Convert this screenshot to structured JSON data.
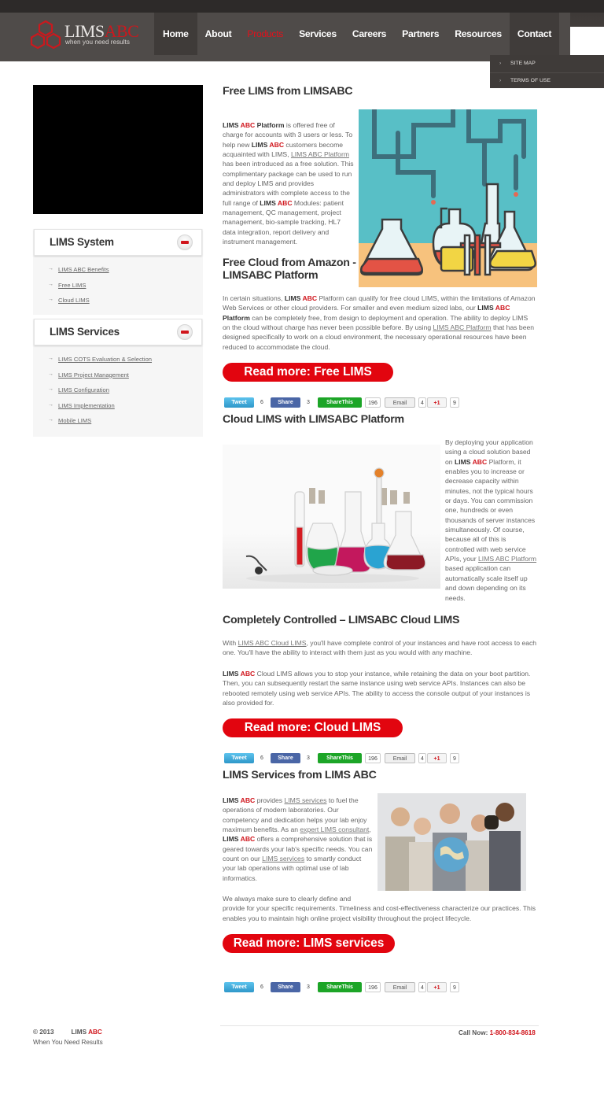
{
  "brand": {
    "name_main": "LIMS",
    "name_accent": "ABC",
    "tagline": "when you need results"
  },
  "nav": {
    "items": [
      "Home",
      "About",
      "Products",
      "Services",
      "Careers",
      "Partners",
      "Resources",
      "Contact"
    ],
    "active": "Products",
    "dropdown": [
      "SITE MAP",
      "TERMS OF USE"
    ]
  },
  "sidebar": {
    "panel1": {
      "title": "LIMS System",
      "items": [
        "LIMS ABC Benefits",
        "Free LIMS",
        "Cloud LIMS"
      ]
    },
    "panel2": {
      "title": "LIMS Services",
      "items": [
        "LIMS COTS Evaluation & Selection",
        "LIMS Project Management",
        "LIMS Configuration",
        "LIMS Implementation",
        "Mobile LIMS"
      ]
    }
  },
  "sections": {
    "free": {
      "title": "Free LIMS from LIMSABC",
      "p1": {
        "a": "LIMS ",
        "b": "ABC",
        "c": " Platform",
        "d": " is offered free of charge for accounts with 3 users or less. To help new ",
        "e": "LIMS ",
        "f": "ABC",
        "g": " customers become acquainted with LIMS, ",
        "link": "LIMS ABC Platform",
        "h": " has been introduced as a free solution. This complimentary package can be used to run and deploy LIMS and provides administrators with complete access to the full range of ",
        "i": "LIMS ",
        "j": "ABC",
        "k": " Modules: patient management, QC management, project management, bio-sample tracking, HL7 data integration, report delivery and instrument management."
      }
    },
    "amazon": {
      "title": "Free Cloud from Amazon - LIMSABC Platform",
      "p": {
        "a": "In certain situations, ",
        "b": "LIMS ",
        "c": "ABC",
        "d": " Platform can qualify for free cloud LIMS, within the limitations of Amazon Web Services or other cloud providers. For smaller and even medium sized labs, our ",
        "e": "LIMS ",
        "f": "ABC",
        "g": " Platform",
        "h": " can be completely free, from design to deployment and operation. The ability to deploy LIMS on the cloud without charge has never been possible before. By using ",
        "link": "LIMS ABC Platform",
        "i": " that has been designed specifically to work on a cloud environment, the necessary operational resources have been reduced to accommodate the cloud."
      },
      "readmore": "Read more: Free LIMS"
    },
    "cloud": {
      "title": "Cloud LIMS with LIMSABC Platform",
      "p": {
        "a": "By deploying your application using a cloud solution based on ",
        "b": "LIMS ",
        "c": "ABC",
        "d": " Platform, it enables you to increase or decrease capacity within minutes, not the typical hours or days. You can commission one, hundreds or even thousands of server instances simultaneously. Of course, because all of this is controlled with web service APIs, your ",
        "link": "LIMS ABC Platform",
        "e": " based application can automatically scale itself up and down depending on its needs."
      }
    },
    "controlled": {
      "title": "Completely Controlled – LIMSABC Cloud LIMS",
      "p1": {
        "a": "With ",
        "link": "LIMS ABC Cloud LIMS",
        "b": ", you'll have complete control of your instances and have root access to each one. You'll have the ability to interact with them just as you would with any machine."
      },
      "p2": {
        "a": "LIMS ",
        "b": "ABC",
        "c": " Cloud LIMS allows you to stop your instance, while retaining the data on your boot partition. Then, you can subsequently restart the same instance using web service APIs. Instances can also be rebooted remotely using web service APIs. The ability to access the console output of your instances is also provided for."
      },
      "readmore": "Read more: Cloud LIMS"
    },
    "services": {
      "title": "LIMS Services from LIMS ABC",
      "p1": {
        "a": "LIMS ",
        "b": "ABC",
        "c": " provides ",
        "link1": "LIMS services",
        "d": " to fuel the operations of modern laboratories. Our competency and dedication helps your lab enjoy maximum benefits. As an ",
        "link2": "expert LIMS consultant",
        "e": ", ",
        "f": "LIMS ",
        "g": "ABC",
        "h": " offers a comprehensive solution that is geared towards your lab's specific needs. You can count on our ",
        "link3": "LIMS services",
        "i": " to smartly conduct your lab operations with optimal use of lab informatics."
      },
      "p2a": "We always make sure to clearly define and",
      "p2b": "provide for your specific requirements. Timeliness and cost-effectiveness characterize our practices. This enables you to maintain high online project visibility throughout the project lifecycle.",
      "readmore": "Read more: LIMS services"
    }
  },
  "share": {
    "tweet": "Tweet",
    "tweet_count": "6",
    "fb": "Share",
    "fb_count": "3",
    "sharethis": "ShareThis",
    "sharethis_count": "196",
    "email": "Email",
    "email_count": "4",
    "gplus": "+1",
    "gplus_count": "9"
  },
  "footer": {
    "copyright": "© 2013",
    "brand_a": "LIMS ",
    "brand_b": "ABC",
    "tagline": "When You Need Results",
    "call_label": "Call Now: ",
    "phone": "1-800-834-8618"
  },
  "colors": {
    "accent": "#e2050f",
    "header": "#4f4b49",
    "nav_active": "#e3101b",
    "text": "#666666"
  }
}
